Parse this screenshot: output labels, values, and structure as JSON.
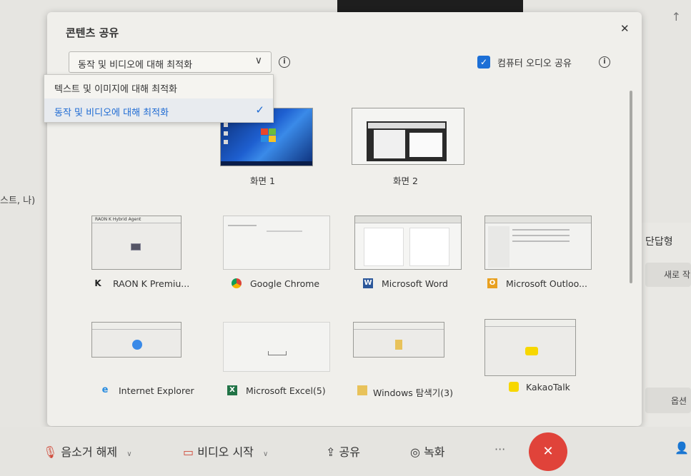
{
  "dialog": {
    "title": "콘텐츠 공유",
    "optimize_selected": "동작 및 비디오에 대해 최적화",
    "optimize_options": [
      "텍스트 및 이미지에 대해 최적화",
      "동작 및 비디오에 대해 최적화"
    ],
    "share_audio_label": "컴퓨터 오디오 공유",
    "share_audio_checked": true,
    "screens": [
      {
        "label": "화면 1"
      },
      {
        "label": "화면 2"
      }
    ],
    "apps_row1": [
      {
        "label": "RAON K Premiu...",
        "icon": "raon-k-icon"
      },
      {
        "label": "Google Chrome",
        "icon": "chrome-icon"
      },
      {
        "label": "Microsoft Word",
        "icon": "word-icon"
      },
      {
        "label": "Microsoft Outloo...",
        "icon": "outlook-icon"
      }
    ],
    "apps_row2": [
      {
        "label": "Internet Explorer",
        "icon": "ie-icon"
      },
      {
        "label": "Microsoft Excel(5)",
        "icon": "excel-icon"
      },
      {
        "label": "Windows 탐색기(3)",
        "icon": "folder-icon"
      },
      {
        "label": "KakaoTalk",
        "icon": "kakaotalk-icon"
      }
    ],
    "raon_thumb_text": "RAON K Hybrid Agent"
  },
  "toolbar": {
    "unmute": "음소거 해제",
    "start_video": "비디오 시작",
    "share": "공유",
    "record": "녹화",
    "more": "···"
  },
  "background": {
    "left_text": "스트, 나)",
    "right_label": "단답형",
    "right_button": "새로 작",
    "right_button2": "옵션"
  },
  "colors": {
    "accent": "#1c6fd6",
    "end_button": "#e0433a"
  }
}
